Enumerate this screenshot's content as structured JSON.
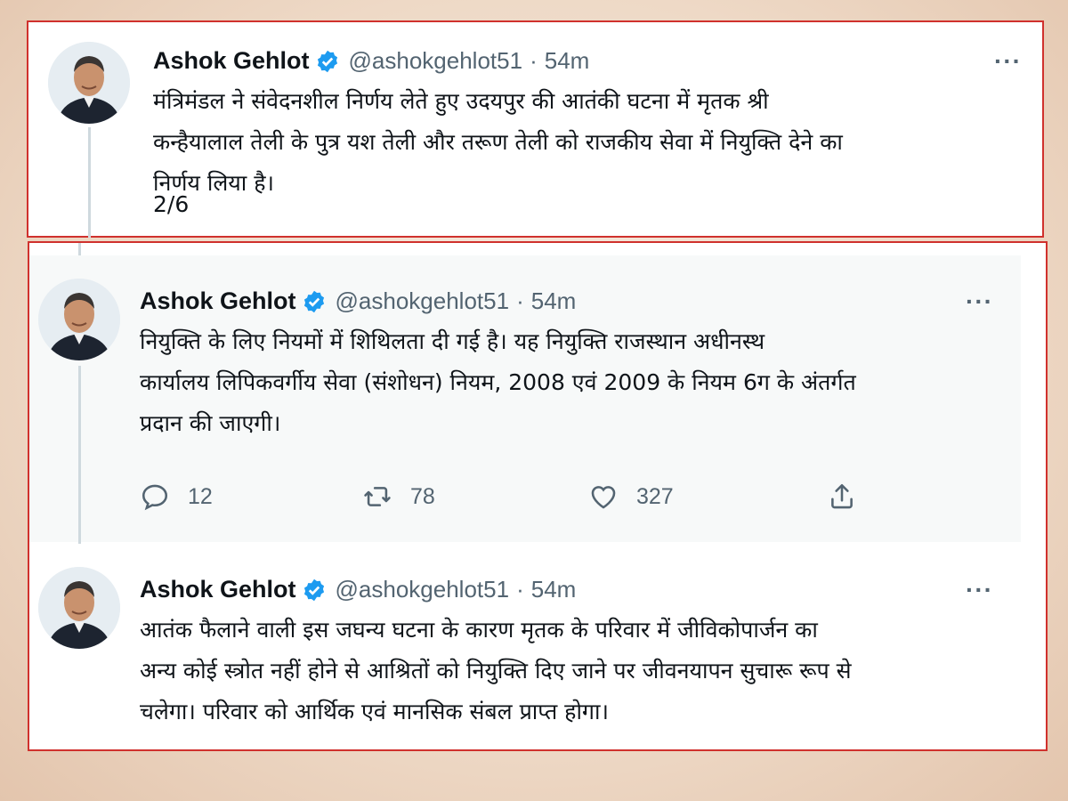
{
  "tweets": [
    {
      "author_name": "Ashok Gehlot",
      "handle": "@ashokgehlot51",
      "separator": "·",
      "time": "54m",
      "more_label": "···",
      "text": "मंत्रिमंडल ने संवेदनशील निर्णय लेते हुए उदयपुर की आतंकी घटना में मृतक श्री\nकन्हैयालाल तेली के पुत्र यश तेली और तरूण तेली को राजकीय सेवा में नियुक्ति देने का\nनिर्णय लिया है।",
      "thread_count": "2/6",
      "verified_icon": "verified-badge-icon"
    },
    {
      "author_name": "Ashok Gehlot",
      "handle": "@ashokgehlot51",
      "separator": "·",
      "time": "54m",
      "more_label": "···",
      "text": "नियुक्ति के लिए नियमों में शिथिलता दी गई है। यह नियुक्ति राजस्थान अधीनस्थ\nकार्यालय लिपिकवर्गीय सेवा (संशोधन) नियम, 2008 एवं 2009 के नियम 6ग के अंतर्गत\nप्रदान की जाएगी।",
      "replies": "12",
      "retweets": "78",
      "likes": "327",
      "verified_icon": "verified-badge-icon"
    },
    {
      "author_name": "Ashok Gehlot",
      "handle": "@ashokgehlot51",
      "separator": "·",
      "time": "54m",
      "more_label": "···",
      "text": "आतंक फैलाने वाली इस जघन्य घटना के कारण मृतक के परिवार में जीविकोपार्जन का\nअन्य कोई स्त्रोत नहीं होने से आश्रितों को नियुक्ति दिए जाने पर जीवनयापन सुचारू रूप से\nचलेगा। परिवार को आर्थिक एवं मानसिक संबल प्राप्त होगा।",
      "verified_icon": "verified-badge-icon"
    }
  ],
  "colors": {
    "frame_border": "#d0312d",
    "verified_blue": "#1d9bf0",
    "secondary_text": "#536471",
    "thread_line": "#cfd9de"
  },
  "icons": [
    "reply-icon",
    "retweet-icon",
    "like-icon",
    "share-icon",
    "more-icon",
    "verified-badge-icon"
  ]
}
